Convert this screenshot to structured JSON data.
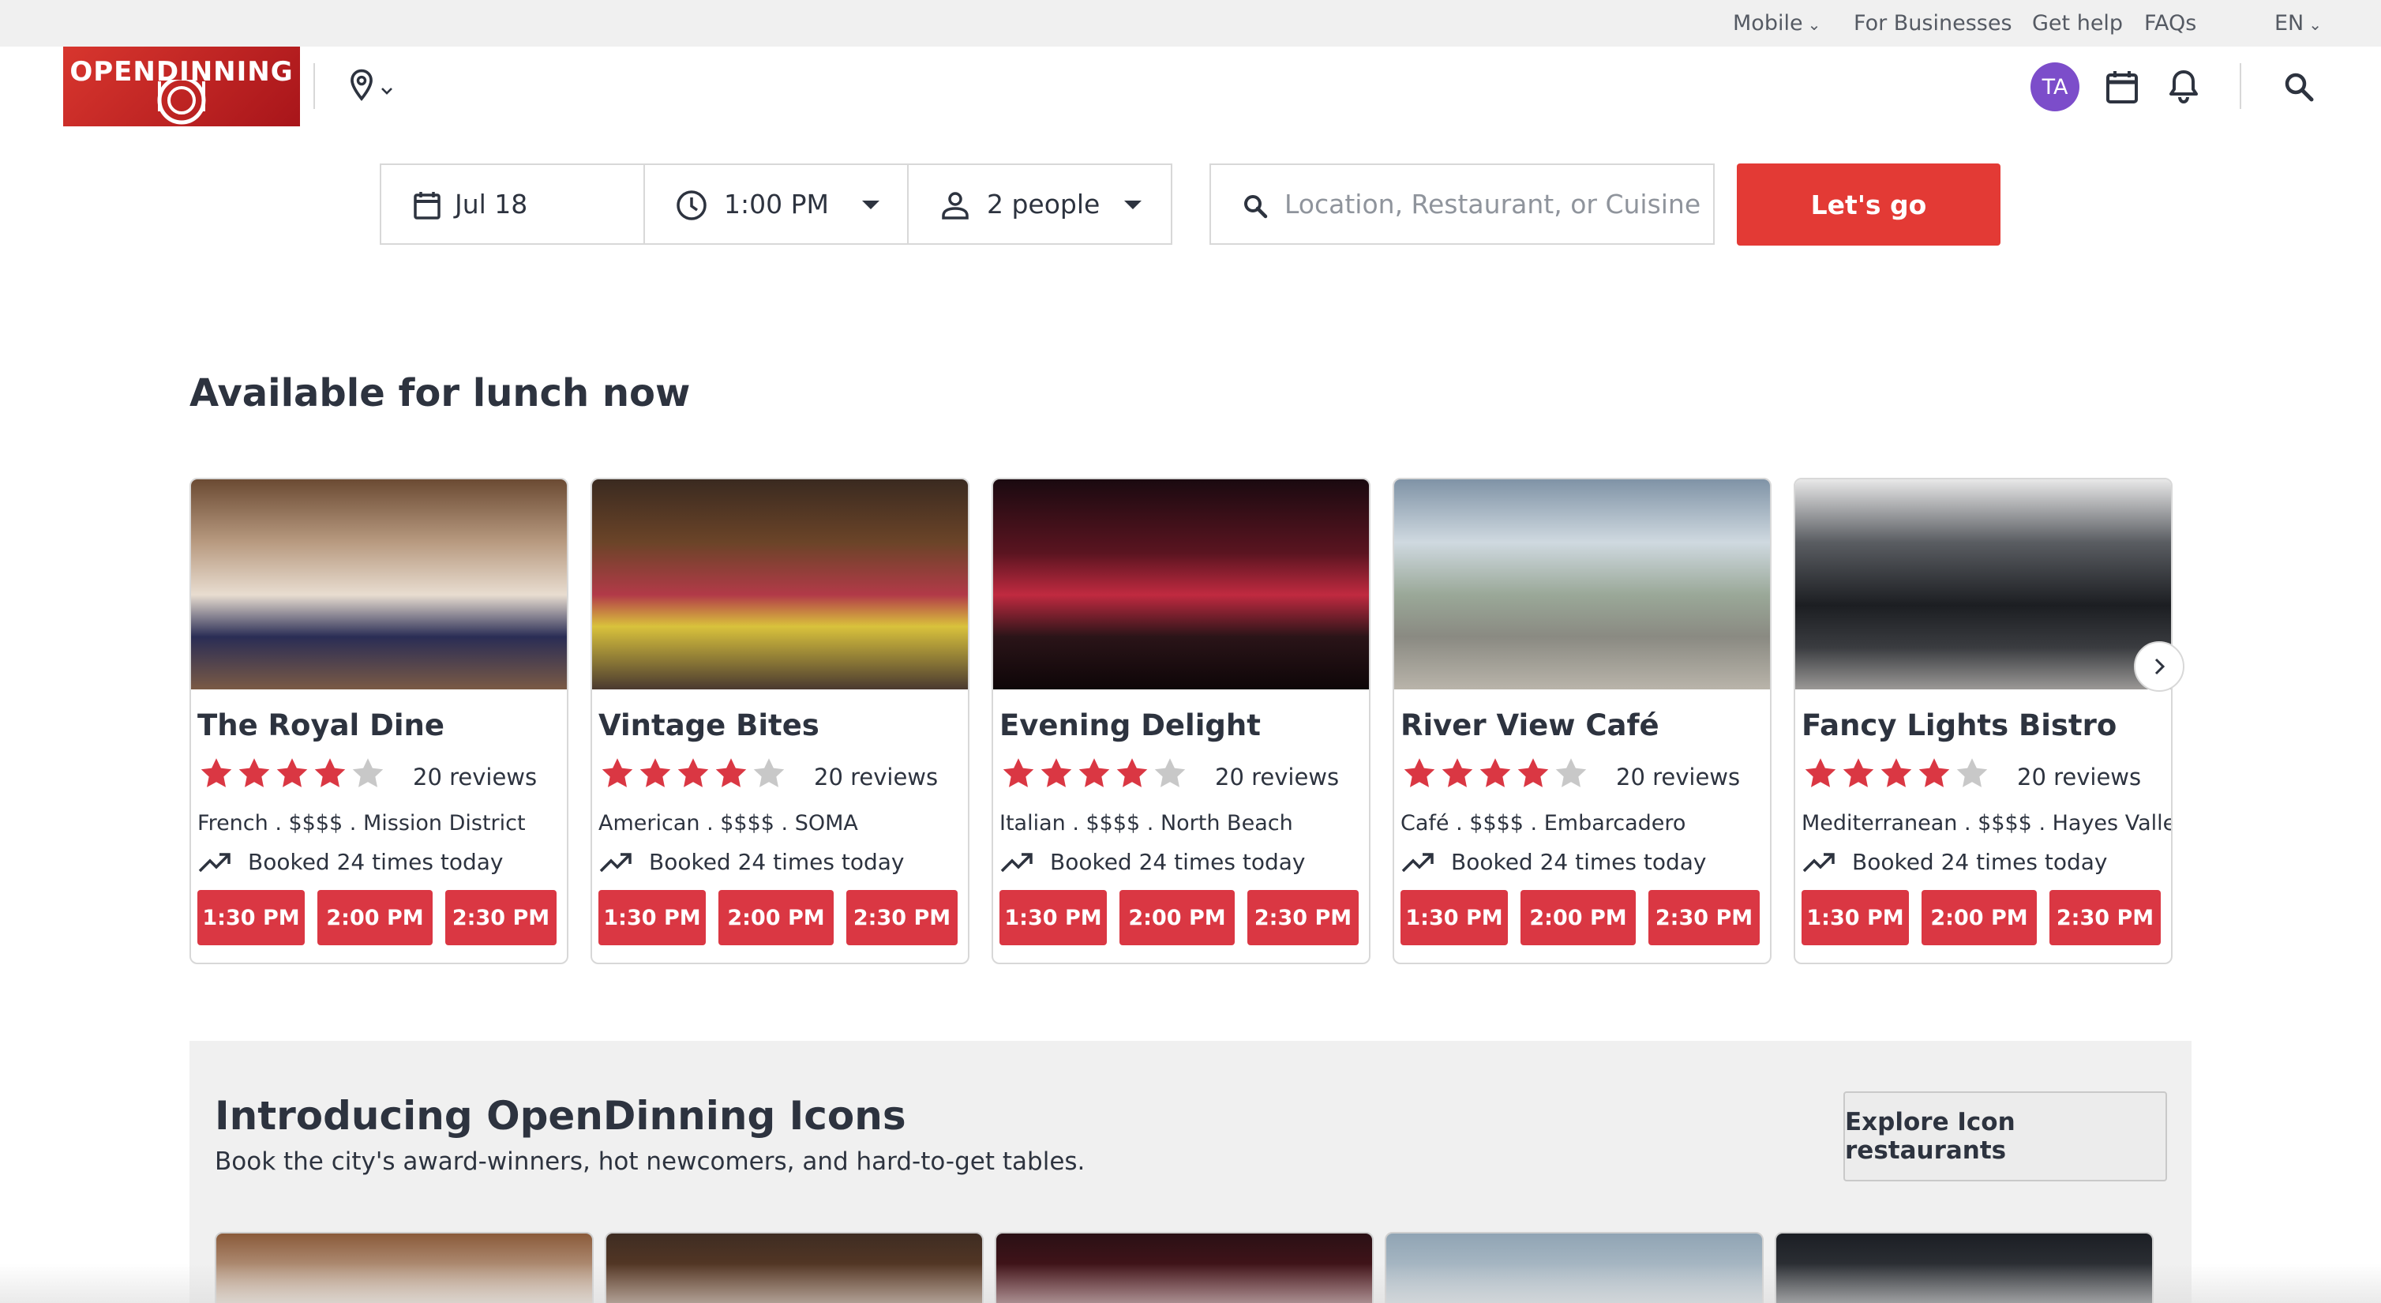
{
  "utility_bar": {
    "mobile": "Mobile",
    "for_businesses": "For Businesses",
    "get_help": "Get help",
    "faqs": "FAQs",
    "language": "EN"
  },
  "header": {
    "logo_text": "OPENDINNING",
    "location_icon": "map-pin-icon",
    "avatar_initials": "TA",
    "icons": [
      "calendar-icon",
      "bell-icon",
      "search-icon"
    ]
  },
  "search": {
    "date": "Jul 18",
    "time": "1:00 PM",
    "party": "2 people",
    "placeholder": "Location, Restaurant, or Cuisine",
    "submit_label": "Let's go"
  },
  "lunch_section": {
    "title": "Available for lunch now",
    "restaurants": [
      {
        "name": "The Royal Dine",
        "rating": 4,
        "reviews": "20 reviews",
        "meta": "French . $$$$ . Mission District",
        "booked": "Booked 24 times today",
        "slots": [
          "1:30 PM",
          "2:00 PM",
          "2:30 PM"
        ]
      },
      {
        "name": "Vintage Bites",
        "rating": 4,
        "reviews": "20 reviews",
        "meta": "American . $$$$ . SOMA",
        "booked": "Booked 24 times today",
        "slots": [
          "1:30 PM",
          "2:00 PM",
          "2:30 PM"
        ]
      },
      {
        "name": "Evening Delight",
        "rating": 4,
        "reviews": "20 reviews",
        "meta": "Italian . $$$$ . North Beach",
        "booked": "Booked 24 times today",
        "slots": [
          "1:30 PM",
          "2:00 PM",
          "2:30 PM"
        ]
      },
      {
        "name": "River View Café",
        "rating": 4,
        "reviews": "20 reviews",
        "meta": "Café . $$$$ . Embarcadero",
        "booked": "Booked 24 times today",
        "slots": [
          "1:30 PM",
          "2:00 PM",
          "2:30 PM"
        ]
      },
      {
        "name": "Fancy Lights Bistro",
        "rating": 4,
        "reviews": "20 reviews",
        "meta": "Mediterranean . $$$$ . Hayes Valley",
        "booked": "Booked 24 times today",
        "slots": [
          "1:30 PM",
          "2:00 PM",
          "2:30 PM"
        ]
      }
    ]
  },
  "icons_section": {
    "title": "Introducing OpenDinning Icons",
    "subtitle": "Book the city's award-winners, hot newcomers, and hard-to-get tables.",
    "explore_label": "Explore Icon restaurants"
  },
  "colors": {
    "accent": "#da3743",
    "avatar": "#7c4dca",
    "star_filled": "#da3743",
    "star_empty": "#c8c8c8"
  }
}
